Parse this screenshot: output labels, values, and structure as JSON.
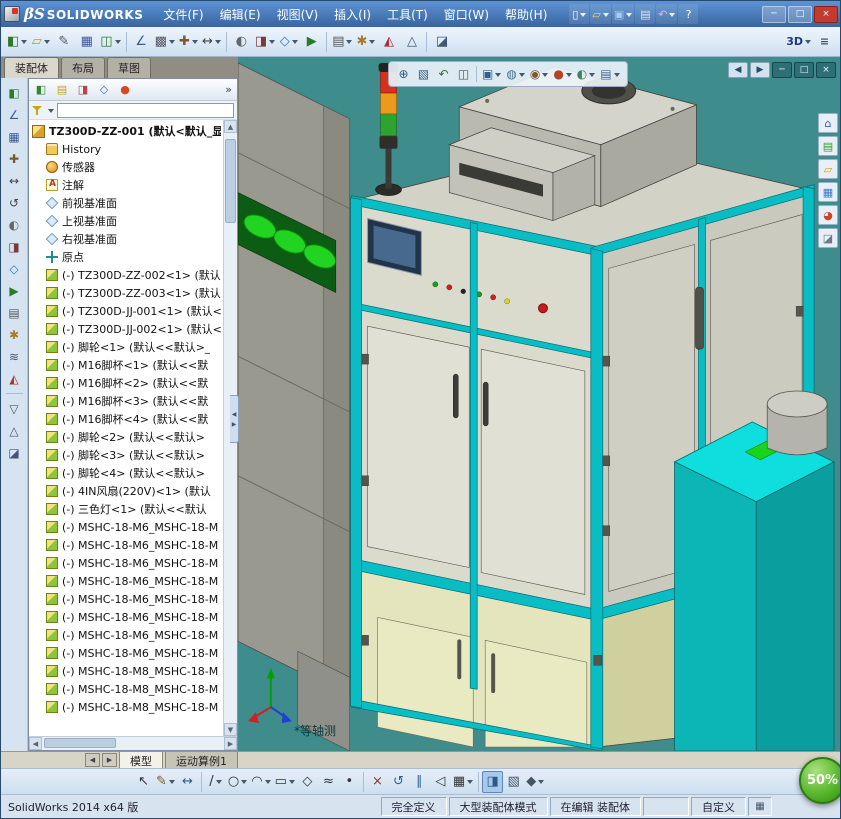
{
  "titlebar": {
    "logo_beta": "βS",
    "logo_text": "SOLIDWORKS",
    "menus": [
      {
        "label": "文件(F)"
      },
      {
        "label": "编辑(E)"
      },
      {
        "label": "视图(V)"
      },
      {
        "label": "插入(I)"
      },
      {
        "label": "工具(T)"
      },
      {
        "label": "窗口(W)"
      },
      {
        "label": "帮助(H)"
      }
    ],
    "quickbar": [
      {
        "name": "new-document",
        "glyph": "▯",
        "color": "#ffffff",
        "caret": true
      },
      {
        "name": "open-document",
        "glyph": "▱",
        "color": "#ffd264",
        "caret": true
      },
      {
        "name": "save-document",
        "glyph": "▣",
        "color": "#a8c8f0",
        "caret": true
      },
      {
        "name": "print-document",
        "glyph": "▤",
        "color": "#e0e8f4"
      },
      {
        "name": "undo",
        "glyph": "↶",
        "color": "#d4b6f2",
        "caret": true
      },
      {
        "name": "help",
        "glyph": "?",
        "color": "#ffffff"
      }
    ],
    "window_buttons": [
      {
        "name": "minimize-button",
        "glyph": "─"
      },
      {
        "name": "maximize-button",
        "glyph": "□"
      },
      {
        "name": "close-button",
        "glyph": "×",
        "close": true
      }
    ]
  },
  "toolbar": [
    {
      "name": "new-assembly",
      "glyph": "◧",
      "color": "#2d7a2d",
      "caret": true
    },
    {
      "name": "open",
      "glyph": "▱",
      "color": "#c8921e",
      "caret": true
    },
    {
      "name": "attachments",
      "glyph": "✎",
      "color": "#556"
    },
    {
      "name": "component-structure",
      "glyph": "▦",
      "color": "#3a5a9a"
    },
    {
      "name": "insert-components",
      "glyph": "◫",
      "color": "#2d7a2d",
      "caret": true
    },
    {
      "sep": true
    },
    {
      "name": "mate",
      "glyph": "∠",
      "color": "#3a5a9a"
    },
    {
      "name": "linear-component-pattern",
      "glyph": "▩",
      "color": "#556",
      "caret": true
    },
    {
      "name": "smart-fasteners",
      "glyph": "✚",
      "color": "#7a5a2a",
      "caret": true
    },
    {
      "name": "move-component",
      "glyph": "↔",
      "color": "#444",
      "caret": true
    },
    {
      "sep": true
    },
    {
      "name": "show-hidden-components",
      "glyph": "◐",
      "color": "#666"
    },
    {
      "name": "assembly-features",
      "glyph": "◨",
      "color": "#7a3a3a",
      "caret": true
    },
    {
      "name": "reference-geometry",
      "glyph": "◇",
      "color": "#2a7aaa",
      "caret": true
    },
    {
      "name": "new-motion-study",
      "glyph": "▶",
      "color": "#2a7a2a"
    },
    {
      "sep": true
    },
    {
      "name": "bill-of-materials",
      "glyph": "▤",
      "color": "#555",
      "caret": true
    },
    {
      "name": "exploded-view",
      "glyph": "✱",
      "color": "#aa7a2a",
      "caret": true
    },
    {
      "name": "interference-detection",
      "glyph": "◭",
      "color": "#aa3333"
    },
    {
      "name": "measure",
      "glyph": "△",
      "color": "#445577"
    },
    {
      "sep": true
    },
    {
      "name": "section-tool",
      "glyph": "◪",
      "color": "#445577"
    }
  ],
  "toolbar_right": [
    {
      "name": "3d-drawing-view",
      "glyph": "3D",
      "color": "#223a7a",
      "caret": true
    },
    {
      "name": "options-flyout",
      "glyph": "≡",
      "color": "#445566"
    }
  ],
  "command_tabs": [
    {
      "label": "装配体",
      "active": true
    },
    {
      "label": "布局"
    },
    {
      "label": "草图"
    }
  ],
  "left_strip": [
    {
      "name": "insert-component",
      "glyph": "◧",
      "color": "#2d7a2d"
    },
    {
      "name": "mate",
      "glyph": "∠",
      "color": "#3a5a9a"
    },
    {
      "name": "component-pattern",
      "glyph": "▦",
      "color": "#3a5a9a"
    },
    {
      "name": "smart-fasteners",
      "glyph": "✚",
      "color": "#7a5a2a"
    },
    {
      "name": "move-component",
      "glyph": "↔",
      "color": "#444444"
    },
    {
      "name": "rotate-component",
      "glyph": "↺",
      "color": "#444444"
    },
    {
      "name": "show-hidden-components",
      "glyph": "◐",
      "color": "#666666"
    },
    {
      "name": "assembly-features",
      "glyph": "◨",
      "color": "#7a3a3a"
    },
    {
      "name": "reference-geometry",
      "glyph": "◇",
      "color": "#2a7aaa"
    },
    {
      "name": "new-motion-study",
      "glyph": "▶",
      "color": "#2a7a2a"
    },
    {
      "name": "bill-of-materials",
      "glyph": "▤",
      "color": "#555555"
    },
    {
      "name": "exploded-view",
      "glyph": "✱",
      "color": "#aa7a2a"
    },
    {
      "name": "explode-line-sketch",
      "glyph": "≋",
      "color": "#445577"
    },
    {
      "name": "interference-detection",
      "glyph": "◭",
      "color": "#aa3333"
    },
    {
      "sep": true
    },
    {
      "name": "selection-filter",
      "glyph": "▽",
      "color": "#555555"
    },
    {
      "name": "measure",
      "glyph": "△",
      "color": "#445577"
    },
    {
      "name": "section-view",
      "glyph": "◪",
      "color": "#445577"
    }
  ],
  "tree_header": [
    {
      "name": "featuremanager-tree-tab",
      "glyph": "◧",
      "color": "#2d8a2d"
    },
    {
      "name": "propertymanager-tab",
      "glyph": "▤",
      "color": "#c8a020"
    },
    {
      "name": "configurationmanager-tab",
      "glyph": "◨",
      "color": "#b04848"
    },
    {
      "name": "dimxpertmanager-tab",
      "glyph": "◇",
      "color": "#3a6aaa"
    },
    {
      "name": "displaymanager-tab",
      "glyph": "●",
      "color": "#d24a22"
    }
  ],
  "tree_header_more": "»",
  "filter": {
    "value": ""
  },
  "tree": {
    "root": {
      "icon": "asm-root",
      "label": "TZ300D-ZZ-001 (默认<默认_显"
    },
    "items": [
      {
        "icon": "history",
        "label": "History"
      },
      {
        "icon": "sensor",
        "label": "传感器"
      },
      {
        "icon": "ann",
        "label": "注解"
      },
      {
        "icon": "plane",
        "label": "前视基准面"
      },
      {
        "icon": "plane",
        "label": "上视基准面"
      },
      {
        "icon": "plane",
        "label": "右视基准面"
      },
      {
        "icon": "origin",
        "label": "原点"
      },
      {
        "icon": "part",
        "label": "(-) TZ300D-ZZ-002<1> (默认<"
      },
      {
        "icon": "part",
        "label": "(-) TZ300D-ZZ-003<1> (默认<"
      },
      {
        "icon": "part",
        "label": "(-) TZ300D-JJ-001<1> (默认<"
      },
      {
        "icon": "part",
        "label": "(-) TZ300D-JJ-002<1> (默认<"
      },
      {
        "icon": "part",
        "label": "(-) 脚轮<1> (默认<<默认>_"
      },
      {
        "icon": "part",
        "label": "(-) M16脚杯<1> (默认<<默"
      },
      {
        "icon": "part",
        "label": "(-) M16脚杯<2> (默认<<默"
      },
      {
        "icon": "part",
        "label": "(-) M16脚杯<3> (默认<<默"
      },
      {
        "icon": "part",
        "label": "(-) M16脚杯<4> (默认<<默"
      },
      {
        "icon": "part",
        "label": "(-) 脚轮<2> (默认<<默认>"
      },
      {
        "icon": "part",
        "label": "(-) 脚轮<3> (默认<<默认>"
      },
      {
        "icon": "part",
        "label": "(-) 脚轮<4> (默认<<默认>"
      },
      {
        "icon": "part",
        "label": "(-) 4IN风扇(220V)<1> (默认"
      },
      {
        "icon": "part",
        "label": "(-) 三色灯<1> (默认<<默认"
      },
      {
        "icon": "part",
        "label": "(-) MSHC-18-M6_MSHC-18-M"
      },
      {
        "icon": "part",
        "label": "(-) MSHC-18-M6_MSHC-18-M"
      },
      {
        "icon": "part",
        "label": "(-) MSHC-18-M6_MSHC-18-M"
      },
      {
        "icon": "part",
        "label": "(-) MSHC-18-M6_MSHC-18-M"
      },
      {
        "icon": "part",
        "label": "(-) MSHC-18-M6_MSHC-18-M"
      },
      {
        "icon": "part",
        "label": "(-) MSHC-18-M6_MSHC-18-M"
      },
      {
        "icon": "part",
        "label": "(-) MSHC-18-M6_MSHC-18-M"
      },
      {
        "icon": "part",
        "label": "(-) MSHC-18-M6_MSHC-18-M"
      },
      {
        "icon": "part",
        "label": "(-) MSHC-18-M8_MSHC-18-M"
      },
      {
        "icon": "part",
        "label": "(-) MSHC-18-M8_MSHC-18-M"
      },
      {
        "icon": "part",
        "label": "(-) MSHC-18-M8_MSHC-18-M"
      }
    ]
  },
  "viewport": {
    "view_label": "*等轴测",
    "headsup": [
      {
        "name": "zoom-to-fit",
        "glyph": "⊕",
        "color": "#345b7a"
      },
      {
        "name": "zoom-to-area",
        "glyph": "▧",
        "color": "#345b7a"
      },
      {
        "name": "previous-view",
        "glyph": "↶",
        "color": "#3a6a3a"
      },
      {
        "name": "section-view",
        "glyph": "◫",
        "color": "#555555"
      },
      {
        "sep": true
      },
      {
        "name": "view-orientation",
        "glyph": "▣",
        "color": "#2f5f8f",
        "caret": true
      },
      {
        "name": "display-style",
        "glyph": "◍",
        "color": "#4a708f",
        "caret": true
      },
      {
        "name": "hide-show-items",
        "glyph": "◉",
        "color": "#7a5a2a",
        "caret": true
      },
      {
        "name": "edit-appearance",
        "glyph": "●",
        "color": "#b04428",
        "caret": true
      },
      {
        "name": "apply-scene",
        "glyph": "◐",
        "color": "#3f7f5f",
        "caret": true
      },
      {
        "name": "view-settings",
        "glyph": "▤",
        "color": "#46648a",
        "caret": true
      }
    ],
    "doc_controls": [
      {
        "name": "collapse-panel-left",
        "glyph": "◀"
      },
      {
        "name": "collapse-panel-right",
        "glyph": "▶"
      },
      {
        "name": "doc-minimize",
        "glyph": "─",
        "dark": true
      },
      {
        "name": "doc-restore",
        "glyph": "□",
        "dark": true
      },
      {
        "name": "doc-close",
        "glyph": "×",
        "dark": true
      }
    ],
    "task_pane": [
      {
        "name": "solidworks-resources",
        "glyph": "⌂",
        "color": "#2a62b8"
      },
      {
        "name": "design-library",
        "glyph": "▤",
        "color": "#2f9a2f"
      },
      {
        "name": "file-explorer",
        "glyph": "▱",
        "color": "#d2a01e"
      },
      {
        "name": "view-palette",
        "glyph": "▦",
        "color": "#3a78c8"
      },
      {
        "name": "appearances-scenes",
        "glyph": "◕",
        "color": "#cf4420"
      },
      {
        "name": "custom-properties",
        "glyph": "◪",
        "color": "#6a7a8a"
      }
    ],
    "splitter": {
      "left_glyph": "◀",
      "right_glyph": "▶"
    }
  },
  "bottom_tabs": {
    "prev": "◀",
    "next": "▶",
    "tabs": [
      {
        "label": "模型",
        "active": true
      },
      {
        "label": "运动算例1"
      }
    ]
  },
  "sketch_toolbar": [
    {
      "name": "select-tool",
      "glyph": "↖",
      "color": "#333333"
    },
    {
      "name": "sketch",
      "glyph": "✎",
      "color": "#7a5a22",
      "caret": true
    },
    {
      "name": "smart-dimension",
      "glyph": "↔",
      "color": "#2f5f8f"
    },
    {
      "sep": true
    },
    {
      "name": "line-tool",
      "glyph": "/",
      "color": "#333333",
      "caret": true
    },
    {
      "name": "circle-tool",
      "glyph": "○",
      "color": "#333333",
      "caret": true
    },
    {
      "name": "arc-tool",
      "glyph": "◠",
      "color": "#333333",
      "caret": true
    },
    {
      "name": "rectangle-tool",
      "glyph": "▭",
      "color": "#333333",
      "caret": true
    },
    {
      "name": "polygon-tool",
      "glyph": "◇",
      "color": "#333333"
    },
    {
      "name": "spline-tool",
      "glyph": "≈",
      "color": "#333333"
    },
    {
      "name": "point-tool",
      "glyph": "•",
      "color": "#333333"
    },
    {
      "sep": true
    },
    {
      "name": "trim-entities",
      "glyph": "×",
      "color": "#8a3a2a"
    },
    {
      "name": "convert-entities",
      "glyph": "↺",
      "color": "#2f5f8f"
    },
    {
      "name": "offset-entities",
      "glyph": "∥",
      "color": "#2f5f8f"
    },
    {
      "name": "mirror-entities",
      "glyph": "◁",
      "color": "#333333"
    },
    {
      "name": "linear-sketch-pattern",
      "glyph": "▦",
      "color": "#333333",
      "caret": true
    },
    {
      "sep": true
    },
    {
      "name": "shaded-sketch-contours",
      "glyph": "◨",
      "color": "#2a5a8a",
      "active": true
    },
    {
      "name": "repair-sketch",
      "glyph": "▧",
      "color": "#445566"
    },
    {
      "name": "quick-snaps",
      "glyph": "◆",
      "color": "#445566",
      "caret": true
    }
  ],
  "statusbar": {
    "app_version": "SolidWorks 2014 x64 版",
    "segments": [
      "完全定义",
      "大型装配体模式",
      "在编辑 装配体",
      "",
      "自定义"
    ],
    "grid_icon": "▦"
  },
  "overlay_badge": {
    "label": "50%"
  },
  "colors": {
    "viewport_teal": "#3f8c8c",
    "frame_cyan": "#09bdc4",
    "titlebar_blue": "#38659f",
    "lower_khaki": "#e5e5bd"
  }
}
